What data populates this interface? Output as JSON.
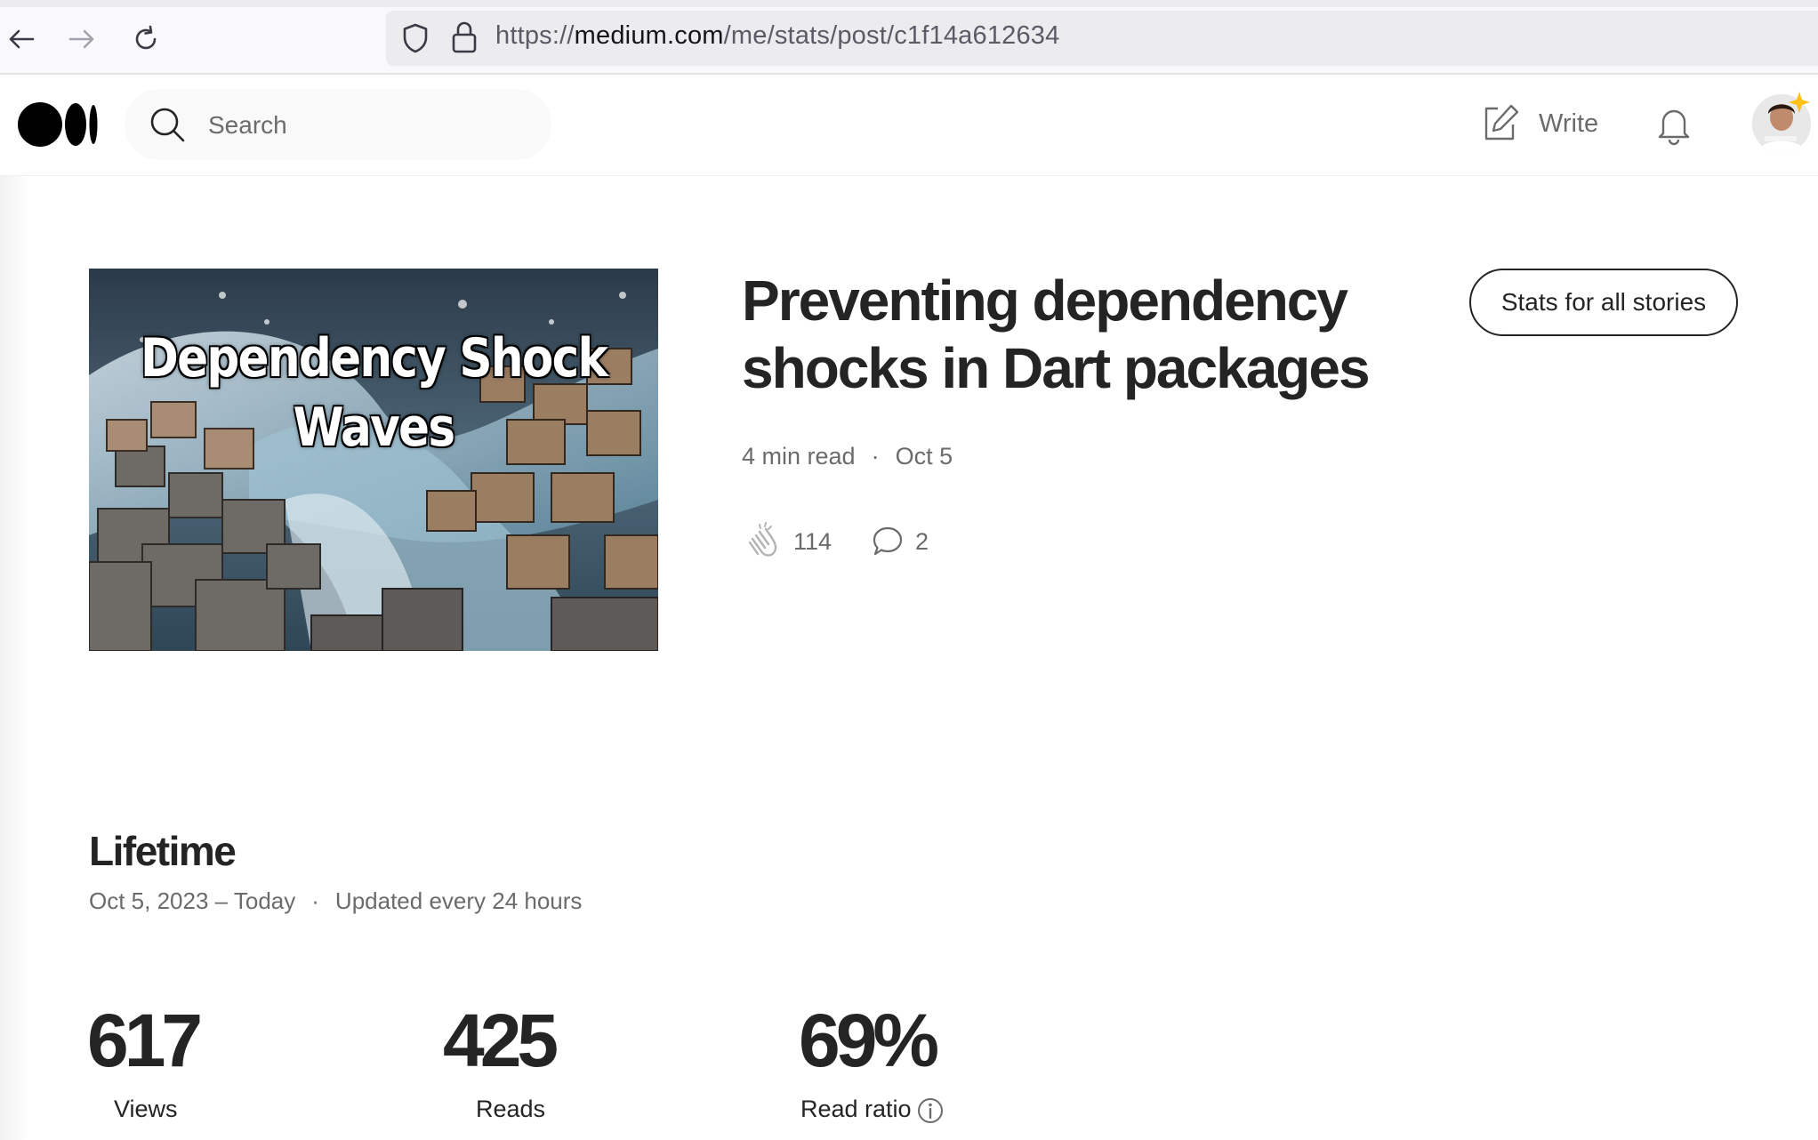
{
  "browser": {
    "url_scheme": "https://",
    "url_host": "medium.com",
    "url_path": "/me/stats/post/c1f14a612634"
  },
  "header": {
    "search_placeholder": "Search",
    "write_label": "Write"
  },
  "story": {
    "image_caption_line1": "Dependency Shock",
    "image_caption_line2": "Waves",
    "title": "Preventing dependency shocks in Dart packages",
    "read_time": "4 min read",
    "meta_separator": "·",
    "date": "Oct 5",
    "claps": "114",
    "responses": "2",
    "stats_all_button": "Stats for all stories"
  },
  "lifetime": {
    "title": "Lifetime",
    "range": "Oct 5, 2023 – Today",
    "separator": "·",
    "update_note": "Updated every 24 hours",
    "stats": [
      {
        "value": "617",
        "label": "Views"
      },
      {
        "value": "425",
        "label": "Reads"
      },
      {
        "value": "69%",
        "label": "Read ratio"
      }
    ]
  },
  "icons": {
    "back": "back-arrow-icon",
    "forward": "forward-arrow-icon",
    "reload": "reload-icon",
    "shield": "shield-icon",
    "lock": "lock-icon",
    "logo": "medium-logo",
    "search": "search-icon",
    "write": "write-icon",
    "bell": "bell-icon",
    "clap": "clap-icon",
    "response": "response-icon",
    "info": "info-icon"
  }
}
